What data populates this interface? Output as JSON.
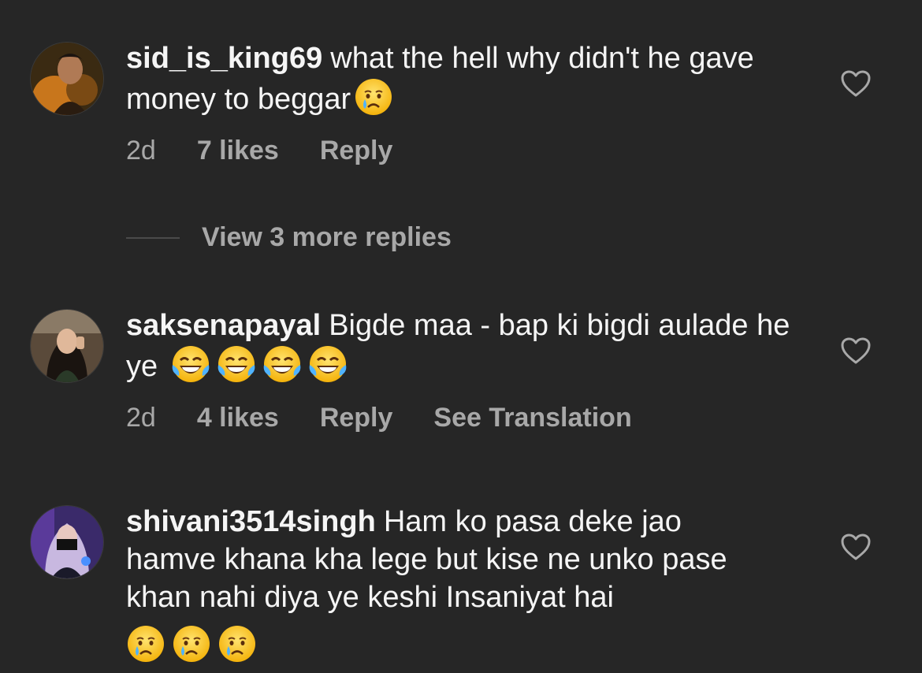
{
  "comments": [
    {
      "username": "sid_is_king69",
      "text": "what the hell why didn't he gave money to beggar",
      "emoji_name": "crying-face",
      "age": "2d",
      "likes": "7 likes",
      "reply": "Reply"
    },
    {
      "username": "saksenapayal",
      "text": "Bigde maa - bap ki bigdi aulade he ye",
      "emoji_name": "tears-of-joy",
      "age": "2d",
      "likes": "4 likes",
      "reply": "Reply",
      "translate": "See Translation"
    },
    {
      "username": "shivani3514singh",
      "text": "Ham ko pasa deke jao hamve khana  kha lege but  kise ne unko pase khan nahi diya ye keshi Insaniyat hai",
      "emoji_name": "crying-face"
    }
  ],
  "view_replies": "View 3 more replies",
  "icons": {
    "like": "heart-outline-icon"
  },
  "colors": {
    "background": "#262626",
    "primary_text": "#f5f5f5",
    "secondary_text": "#a8a8a8"
  }
}
